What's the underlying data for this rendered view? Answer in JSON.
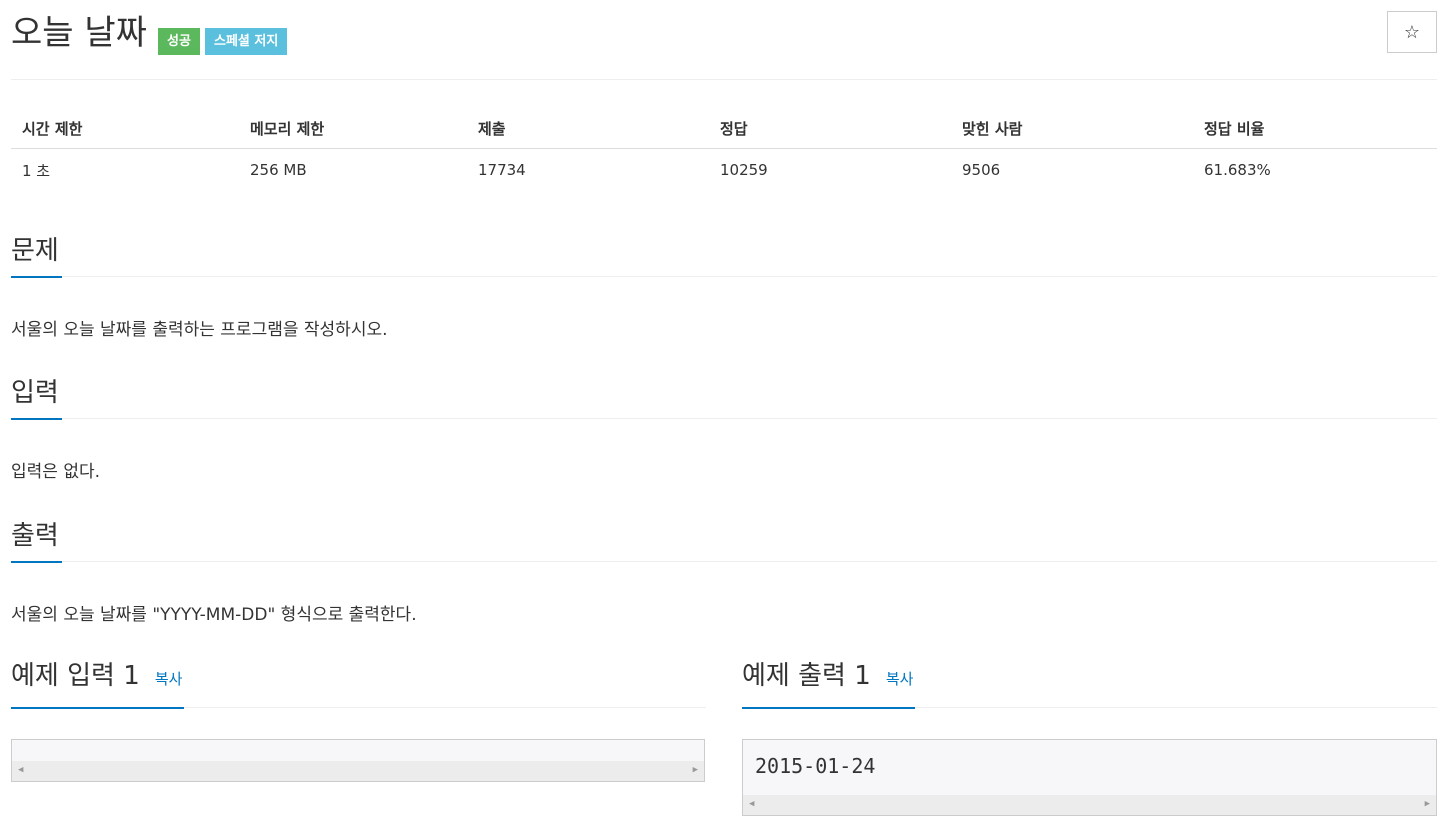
{
  "header": {
    "title": "오늘 날짜",
    "badges": [
      {
        "label": "성공",
        "color": "#5cb85c"
      },
      {
        "label": "스페셜 저지",
        "color": "#5bc0de"
      }
    ],
    "star_icon": "☆"
  },
  "stats": {
    "headers": [
      "시간 제한",
      "메모리 제한",
      "제출",
      "정답",
      "맞힌 사람",
      "정답 비율"
    ],
    "values": [
      "1 초",
      "256 MB",
      "17734",
      "10259",
      "9506",
      "61.683%"
    ]
  },
  "sections": {
    "problem": {
      "title": "문제",
      "text": "서울의 오늘 날짜를 출력하는 프로그램을 작성하시오."
    },
    "input": {
      "title": "입력",
      "text": "입력은 없다."
    },
    "output": {
      "title": "출력",
      "text": "서울의 오늘 날짜를 \"YYYY-MM-DD\" 형식으로 출력한다."
    }
  },
  "examples": {
    "input": {
      "title": "예제 입력 1",
      "copy_label": "복사",
      "content": ""
    },
    "output": {
      "title": "예제 출력 1",
      "copy_label": "복사",
      "content": "2015-01-24"
    }
  },
  "colors": {
    "accent": "#0076c0",
    "success": "#5cb85c",
    "info": "#5bc0de"
  }
}
